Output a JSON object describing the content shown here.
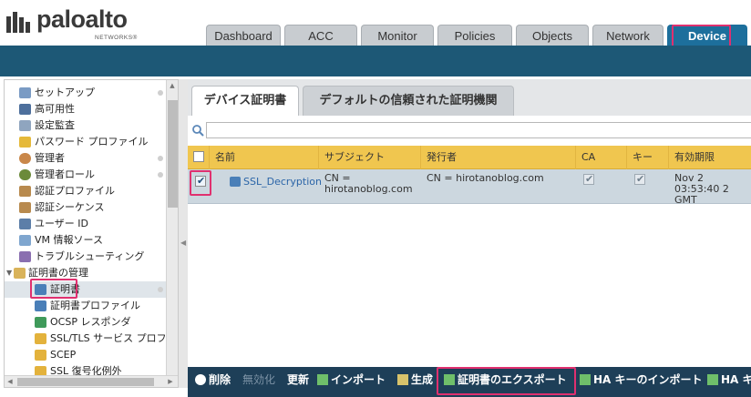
{
  "brand": {
    "name": "paloalto",
    "sub": "NETWORKS®",
    "colors": {
      "header_bar": "#1d5876",
      "active_tab": "#1d6f9c",
      "grid_header": "#f0c64f",
      "highlight": "#e0306f",
      "toolbar": "#1e3f58"
    }
  },
  "top_tabs": [
    {
      "label": "Dashboard"
    },
    {
      "label": "ACC"
    },
    {
      "label": "Monitor"
    },
    {
      "label": "Policies"
    },
    {
      "label": "Objects"
    },
    {
      "label": "Network"
    },
    {
      "label": "Device",
      "active": true
    }
  ],
  "sidebar": {
    "items": [
      {
        "label": "セットアップ",
        "icon": "setup-icon",
        "dot": true
      },
      {
        "label": "高可用性",
        "icon": "ha-icon",
        "dot": false
      },
      {
        "label": "設定監査",
        "icon": "audit-icon",
        "dot": false
      },
      {
        "label": "パスワード プロファイル",
        "icon": "key-icon",
        "dot": false
      },
      {
        "label": "管理者",
        "icon": "user-icon",
        "dot": true
      },
      {
        "label": "管理者ロール",
        "icon": "role-icon",
        "dot": true
      },
      {
        "label": "認証プロファイル",
        "icon": "auth-profile-icon",
        "dot": false
      },
      {
        "label": "認証シーケンス",
        "icon": "auth-sequence-icon",
        "dot": false
      },
      {
        "label": "ユーザー ID",
        "icon": "user-id-icon",
        "dot": false
      },
      {
        "label": "VM 情報ソース",
        "icon": "vm-icon",
        "dot": false
      },
      {
        "label": "トラブルシューティング",
        "icon": "tools-icon",
        "dot": false
      },
      {
        "label": "証明書の管理",
        "icon": "cert-folder-icon",
        "dot": false,
        "expanded": true
      },
      {
        "label": "証明書",
        "icon": "certificate-icon",
        "dot": true,
        "selected": true
      },
      {
        "label": "証明書プロファイル",
        "icon": "cert-profile-icon",
        "dot": false
      },
      {
        "label": "OCSP レスポンダ",
        "icon": "ocsp-icon",
        "dot": false
      },
      {
        "label": "SSL/TLS サービス プロフ:",
        "icon": "lock-icon",
        "dot": false
      },
      {
        "label": "SCEP",
        "icon": "lock-icon",
        "dot": false
      },
      {
        "label": "SSL 復号化例外",
        "icon": "lock-icon",
        "dot": false
      }
    ]
  },
  "subtabs": [
    {
      "label": "デバイス証明書",
      "active": true
    },
    {
      "label": "デフォルトの信頼された証明機関"
    }
  ],
  "search": {
    "placeholder": "",
    "value": ""
  },
  "grid": {
    "columns": [
      "名前",
      "サブジェクト",
      "発行者",
      "CA",
      "キー",
      "有効期限"
    ],
    "rows": [
      {
        "checked": true,
        "name": "SSL_Decryption",
        "subject": [
          "CN =",
          "hirotanoblog.com"
        ],
        "issuer": "CN = hirotanoblog.com",
        "ca": true,
        "key": true,
        "expires": [
          "Nov 2 03:53:40 2",
          "GMT"
        ]
      }
    ]
  },
  "toolbar": {
    "buttons": [
      {
        "label": "削除",
        "icon": "delete-icon",
        "enabled": true
      },
      {
        "label": "無効化",
        "icon": "",
        "enabled": false
      },
      {
        "label": "更新",
        "icon": "",
        "enabled": true
      },
      {
        "label": "インポート",
        "icon": "import-icon",
        "enabled": true
      },
      {
        "label": "生成",
        "icon": "generate-icon",
        "enabled": true
      },
      {
        "label": "証明書のエクスポート",
        "icon": "export-icon",
        "enabled": true
      },
      {
        "label": "HA キーのインポート",
        "icon": "ha-import-icon",
        "enabled": true
      },
      {
        "label": "HA キー",
        "icon": "ha-export-icon",
        "enabled": true
      }
    ]
  }
}
